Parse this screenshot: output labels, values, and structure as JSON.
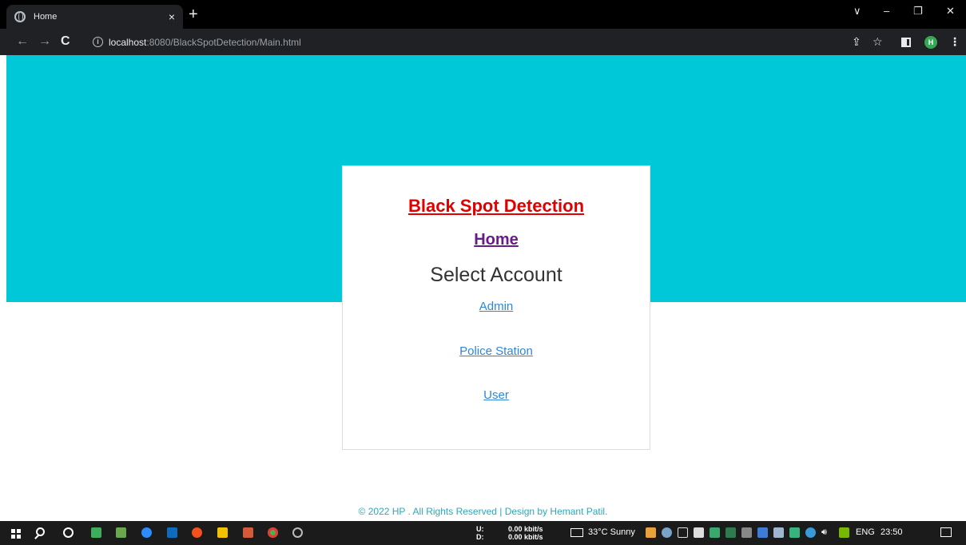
{
  "browser": {
    "tab_title": "Home",
    "tab_close": "×",
    "new_tab": "+",
    "url_host": "localhost",
    "url_rest": ":8080/BlackSpotDetection/Main.html",
    "back": "←",
    "forward": "→",
    "reload": "C",
    "profile_initial": "H",
    "window_controls": {
      "dropdown": "∨",
      "minimize": "–",
      "restore": "❐",
      "close": "✕"
    },
    "toolbar_icons": {
      "share": "⇪",
      "star": "☆",
      "menu": "⋮"
    }
  },
  "page": {
    "brand": "Black Spot Detection",
    "home": "Home",
    "select_heading": "Select Account",
    "accounts": [
      "Admin",
      "Police Station",
      "User"
    ],
    "footer": "© 2022 HP . All Rights Reserved | Design by Hemant Patil."
  },
  "colors": {
    "banner": "#00c8d8",
    "brand_red": "#e00000",
    "home_purple": "#6a1b8a",
    "link_blue": "#2e86d8",
    "footer_teal": "#2aaab8"
  },
  "taskbar": {
    "net_up_label": "U:",
    "net_down_label": "D:",
    "net_up": "0.00 kbit/s",
    "net_down": "0.00 kbit/s",
    "weather": "33°C  Sunny",
    "language": "ENG",
    "time": "23:50"
  }
}
